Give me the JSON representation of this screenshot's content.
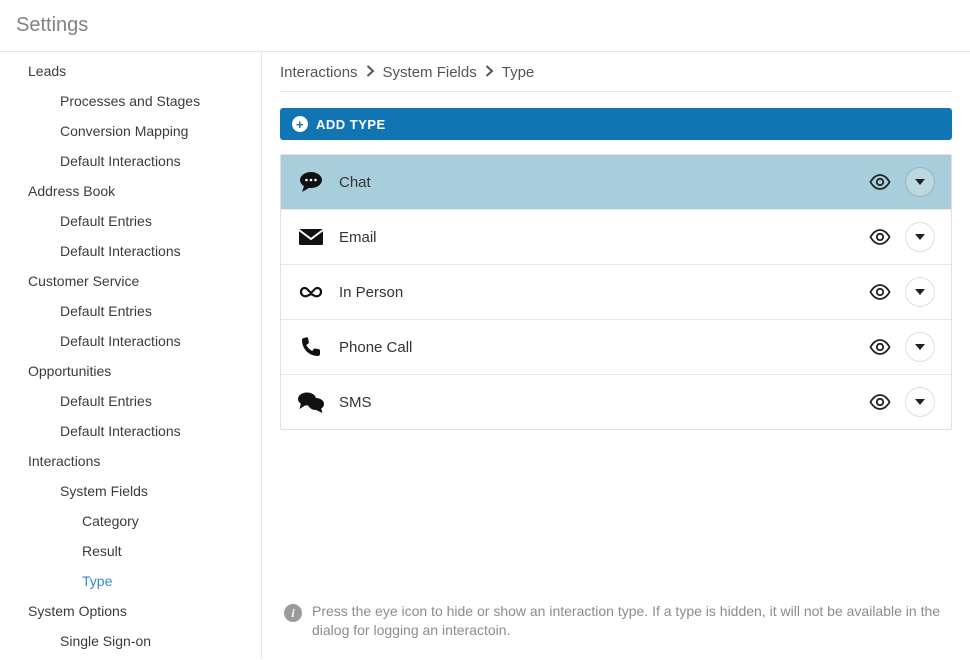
{
  "page_title": "Settings",
  "sidebar": {
    "sections": [
      {
        "label": "Leads",
        "children": [
          {
            "label": "Processes and Stages"
          },
          {
            "label": "Conversion Mapping"
          },
          {
            "label": "Default Interactions"
          }
        ]
      },
      {
        "label": "Address Book",
        "children": [
          {
            "label": "Default Entries"
          },
          {
            "label": "Default Interactions"
          }
        ]
      },
      {
        "label": "Customer Service",
        "children": [
          {
            "label": "Default Entries"
          },
          {
            "label": "Default Interactions"
          }
        ]
      },
      {
        "label": "Opportunities",
        "children": [
          {
            "label": "Default Entries"
          },
          {
            "label": "Default Interactions"
          }
        ]
      },
      {
        "label": "Interactions",
        "children": [
          {
            "label": "System Fields",
            "children": [
              {
                "label": "Category"
              },
              {
                "label": "Result"
              },
              {
                "label": "Type",
                "selected": true
              }
            ]
          }
        ]
      },
      {
        "label": "System Options",
        "children": [
          {
            "label": "Single Sign-on"
          }
        ]
      }
    ]
  },
  "breadcrumb": [
    "Interactions",
    "System Fields",
    "Type"
  ],
  "add_button_label": "ADD TYPE",
  "types": [
    {
      "icon": "chat",
      "label": "Chat",
      "selected": true
    },
    {
      "icon": "email",
      "label": "Email"
    },
    {
      "icon": "in-person",
      "label": "In Person"
    },
    {
      "icon": "phone",
      "label": "Phone Call"
    },
    {
      "icon": "sms",
      "label": "SMS"
    }
  ],
  "hint_text": "Press the eye icon to hide or show an interaction type. If a type is hidden, it will not be available in the dialog for logging an interactoin."
}
